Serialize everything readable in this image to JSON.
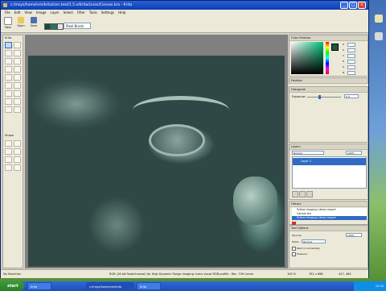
{
  "window": {
    "title": "c:/msys/home/vm/krita/svn.test/1.5.x/Krita/Lines/Canvas.kra - Krita",
    "minimize": "_",
    "maximize": "□",
    "close": "×"
  },
  "menu": [
    "File",
    "Edit",
    "View",
    "Image",
    "Layer",
    "Select",
    "Filter",
    "Tools",
    "Settings",
    "Help"
  ],
  "toolbar": {
    "new_label": "New",
    "open_label": "Open",
    "save_label": "Save",
    "brush": "Pixel Brush"
  },
  "toolbox": {
    "title": "Krita",
    "section2": "Shape"
  },
  "dockers": {
    "color": {
      "title": "Color Selector",
      "fields": [
        "H",
        "S",
        "V",
        "R",
        "G",
        "B"
      ],
      "values": [
        "0",
        "0",
        "0",
        "0",
        "0",
        "0"
      ]
    },
    "palettes_title": "Palettes",
    "histogram": {
      "title": "Histogram",
      "exposure_label": "Exposure:",
      "exposure_value": "0.0"
    },
    "layers": {
      "title": "Layers",
      "mode": "Normal",
      "opacity": "100%",
      "layer_name": "Layer 1"
    },
    "history": {
      "title": "History",
      "items": [
        "Python Imaging Library Import",
        "Canvas.kra",
        "Python Imaging Library Import"
      ]
    },
    "tool_options": {
      "title": "Tool Options",
      "rows": [
        {
          "label": "Opacity:",
          "value": "100%"
        },
        {
          "label": "Mode:",
          "value": "Normal"
        },
        {
          "label": "Paint incrementally",
          "value": ""
        },
        {
          "label": "Pressure",
          "value": ""
        }
      ]
    }
  },
  "status": {
    "left": "No Selection",
    "middle": "RGB (16-bit float/channel) for High Dynamic Range imaging: Icons visual RGB profile - Rec. 709 Linear",
    "zoom": "100 %",
    "size": "781 x 666",
    "coords": "447, 484"
  },
  "taskbar": {
    "start": "start",
    "tasks": [
      "Krita",
      "c:/msys/home/vm/krita",
      "Krita"
    ],
    "time": "12:34"
  },
  "colors": {
    "titlebar": "#0b3fb0",
    "panel": "#ece9d8",
    "selection": "#316ac5"
  }
}
